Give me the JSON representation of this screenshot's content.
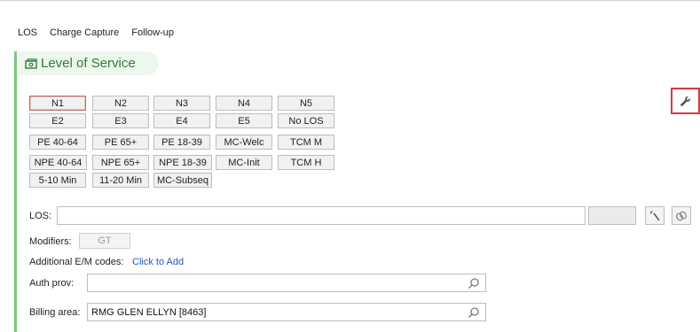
{
  "tabs": [
    "LOS",
    "Charge Capture",
    "Follow-up"
  ],
  "section": {
    "title": "Level of Service",
    "icon": "money-icon"
  },
  "los_buttons": [
    [
      "N1",
      "N2",
      "N3",
      "N4",
      "N5"
    ],
    [
      "E2",
      "E3",
      "E4",
      "E5",
      "No LOS"
    ],
    [
      "PE 40-64",
      "PE 65+",
      "PE 18-39",
      "MC-Welc",
      "TCM M"
    ],
    [
      "NPE 40-64",
      "NPE 65+",
      "NPE 18-39",
      "MC-Init",
      "TCM H"
    ],
    [
      "5-10 Min",
      "11-20 Min",
      "MC-Subseq"
    ]
  ],
  "selected_button": "N1",
  "toolbar": {
    "wrench_icon": "wrench-icon",
    "highlight_color": "#d9383f"
  },
  "form": {
    "los_label": "LOS:",
    "los_value": "",
    "modifiers_label": "Modifiers:",
    "modifier_button": "GT",
    "additional_label": "Additional E/M codes:",
    "additional_link": "Click to Add",
    "auth_label": "Auth prov:",
    "auth_value": "",
    "billing_label": "Billing area:",
    "billing_value": "RMG GLEN ELLYN [8463]"
  },
  "colors": {
    "accent_green": "#2e7d32",
    "edge_green": "#7dc77d",
    "link_blue": "#2457b8"
  }
}
